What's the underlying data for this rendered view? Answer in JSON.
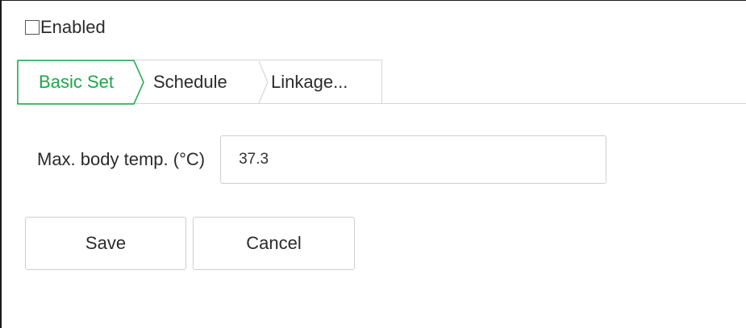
{
  "enable": {
    "label": "Enabled",
    "checked": false
  },
  "tabs": [
    {
      "label": "Basic Set",
      "active": true
    },
    {
      "label": "Schedule",
      "active": false
    },
    {
      "label": "Linkage...",
      "active": false
    }
  ],
  "form": {
    "max_temp_label": "Max. body temp. (°C)",
    "max_temp_value": "37.3"
  },
  "buttons": {
    "save_label": "Save",
    "cancel_label": "Cancel"
  },
  "colors": {
    "active_tab": "#1aa84a",
    "border": "#d6d6d6",
    "text": "#2b2b2b"
  }
}
